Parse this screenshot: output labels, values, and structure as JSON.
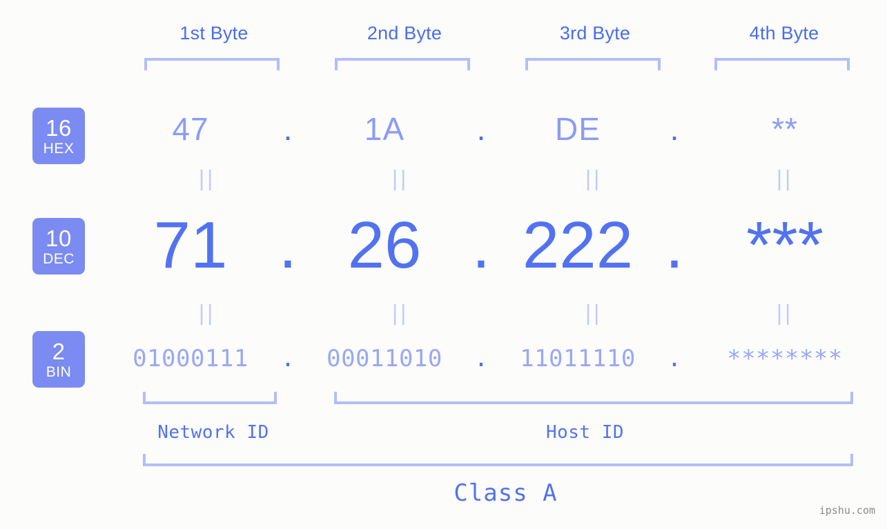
{
  "background_color": "#fcfdfa",
  "accent_color": "#5272f0",
  "bracket_color": "#b4bdfa",
  "badge_color": "#7b8bf2",
  "byte_headers": [
    {
      "label": "1st Byte"
    },
    {
      "label": "2nd Byte"
    },
    {
      "label": "3rd Byte"
    },
    {
      "label": "4th Byte"
    }
  ],
  "rows": {
    "hex": {
      "base_number": "16",
      "base_name": "HEX",
      "bytes": [
        "47",
        "1A",
        "DE",
        "**"
      ],
      "separator": "."
    },
    "dec": {
      "base_number": "10",
      "base_name": "DEC",
      "bytes": [
        "71",
        "26",
        "222",
        "***"
      ],
      "separator": "."
    },
    "bin": {
      "base_number": "2",
      "base_name": "BIN",
      "bytes": [
        "01000111",
        "00011010",
        "11011110",
        "********"
      ],
      "separator": "."
    }
  },
  "connectors": {
    "symbol": "||",
    "hex_to_dec": [
      "||",
      "||",
      "||",
      "||"
    ],
    "dec_to_bin": [
      "||",
      "||",
      "||",
      "||"
    ]
  },
  "sections": {
    "network_id": "Network ID",
    "host_id": "Host ID",
    "class": "Class A"
  },
  "watermark": "ipshu.com"
}
